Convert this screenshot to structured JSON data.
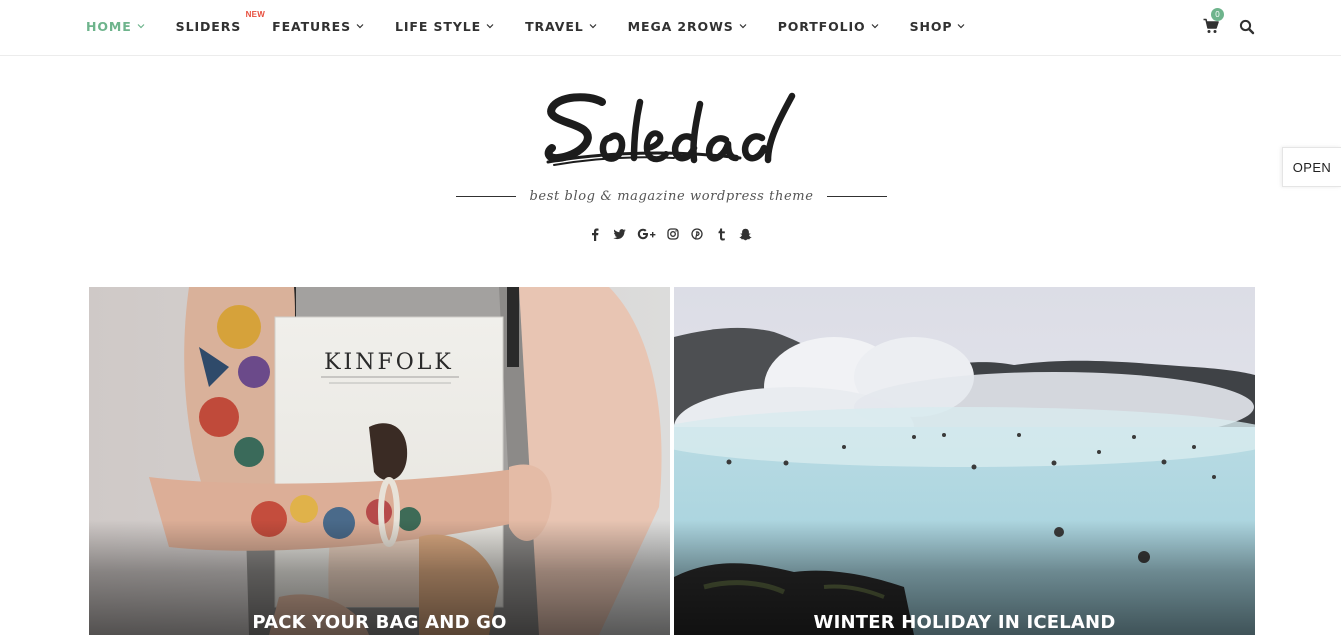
{
  "nav": {
    "items": [
      {
        "label": "HOME",
        "active": true,
        "dropdown": true
      },
      {
        "label": "SLIDERS",
        "badge": "NEW",
        "dropdown": false
      },
      {
        "label": "FEATURES",
        "dropdown": true
      },
      {
        "label": "LIFE STYLE",
        "dropdown": true
      },
      {
        "label": "TRAVEL",
        "dropdown": true
      },
      {
        "label": "MEGA 2ROWS",
        "dropdown": true
      },
      {
        "label": "PORTFOLIO",
        "dropdown": true
      },
      {
        "label": "SHOP",
        "dropdown": true
      }
    ],
    "cart_count": "0",
    "icons": {
      "cart": "shopping-cart-icon",
      "search": "search-icon"
    },
    "accent_color": "#6eb48c",
    "badge_color": "#e74c3c"
  },
  "header": {
    "logo_text": "Soledad",
    "tagline": "best blog & magazine wordpress theme",
    "socials": [
      "facebook-icon",
      "twitter-icon",
      "google-plus-icon",
      "instagram-icon",
      "pinterest-icon",
      "tumblr-icon",
      "snapchat-icon"
    ]
  },
  "side_tab": {
    "label": "OPEN"
  },
  "featured": [
    {
      "title": "PACK YOUR BAG AND GO",
      "image_text": "KINFOLK"
    },
    {
      "title": "WINTER HOLIDAY IN ICELAND"
    }
  ]
}
